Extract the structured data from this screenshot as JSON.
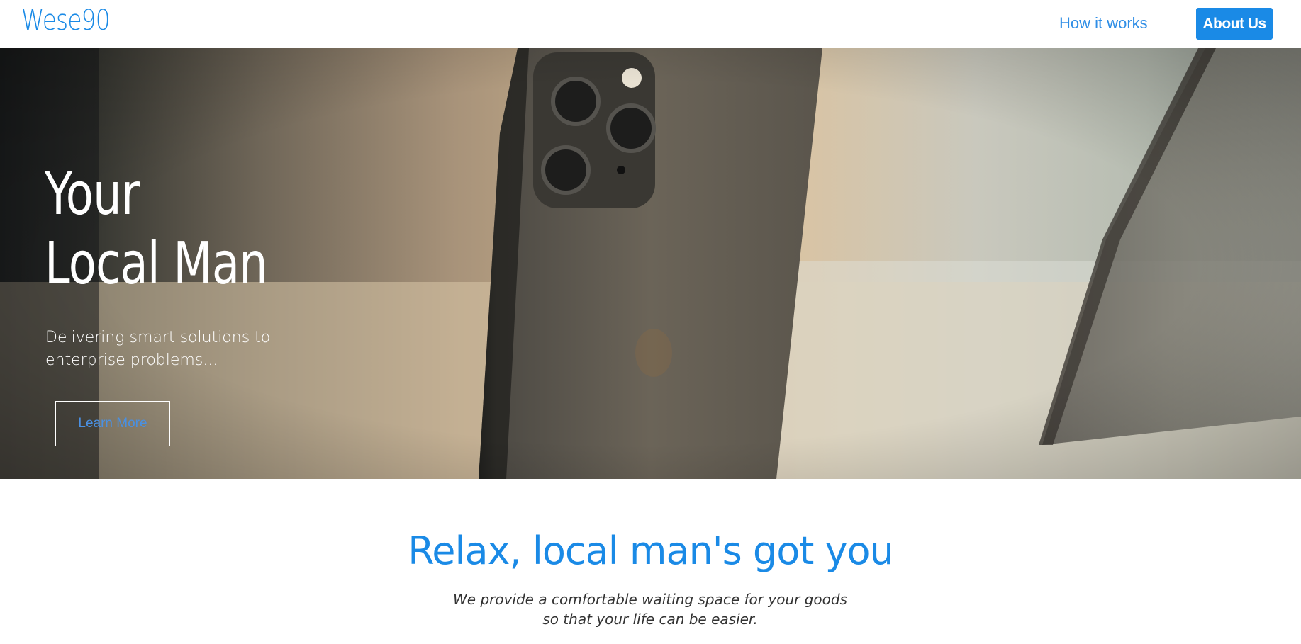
{
  "nav": {
    "brand": "Wese90",
    "links": [
      "How it works"
    ],
    "cta": "About Us"
  },
  "hero": {
    "title_line1": "Your",
    "title_line2": "Local Man",
    "subtitle": "Delivering smart solutions to enterprise problems...",
    "button": "Learn More"
  },
  "section": {
    "title": "Relax, local man's got you",
    "subtitle_line1": "We provide a comfortable waiting space for your goods",
    "subtitle_line2": "so that your life can be easier."
  },
  "colors": {
    "accent": "#1a8ae6",
    "nav_link": "#2f8ee6",
    "hero_button_text": "#4a90e2"
  }
}
